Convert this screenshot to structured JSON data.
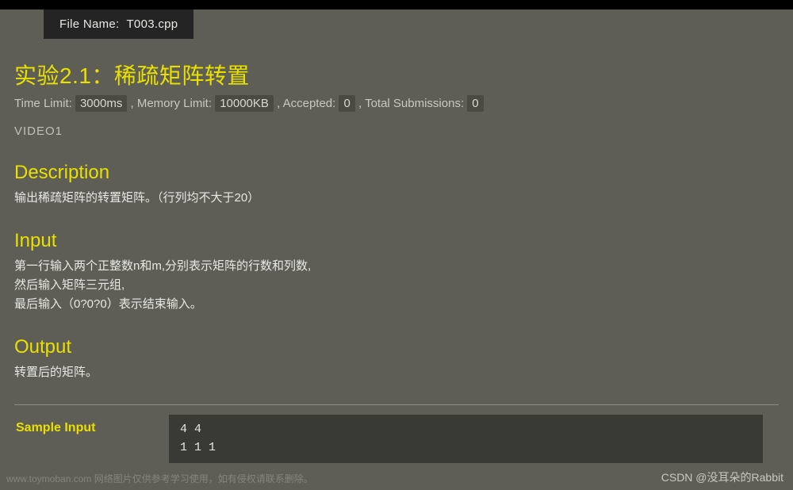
{
  "file_tab": {
    "label": "File Name:",
    "value": "T003.cpp"
  },
  "problem": {
    "title": "实验2.1：稀疏矩阵转置",
    "limits": {
      "time_label": "Time Limit:",
      "time_value": "3000ms",
      "memory_label": ", Memory Limit:",
      "memory_value": "10000KB",
      "accepted_label": ", Accepted:",
      "accepted_value": "0",
      "submissions_label": ", Total Submissions:",
      "submissions_value": "0"
    },
    "video_label": "VIDEO1"
  },
  "sections": {
    "description": {
      "heading": "Description",
      "text": "输出稀疏矩阵的转置矩阵。（行列均不大于20）"
    },
    "input": {
      "heading": "Input",
      "text": "第一行输入两个正整数n和m,分别表示矩阵的行数和列数,\n然后输入矩阵三元组,\n最后输入（0?0?0）表示结束输入。"
    },
    "output": {
      "heading": "Output",
      "text": "转置后的矩阵。"
    }
  },
  "sample": {
    "input_label": "Sample Input",
    "input_content": "4 4\n1 1 1"
  },
  "watermarks": {
    "left": "www.toymoban.com  网络图片仅供参考学习使用，如有侵权请联系删除。",
    "right": "CSDN @没耳朵的Rabbit"
  }
}
